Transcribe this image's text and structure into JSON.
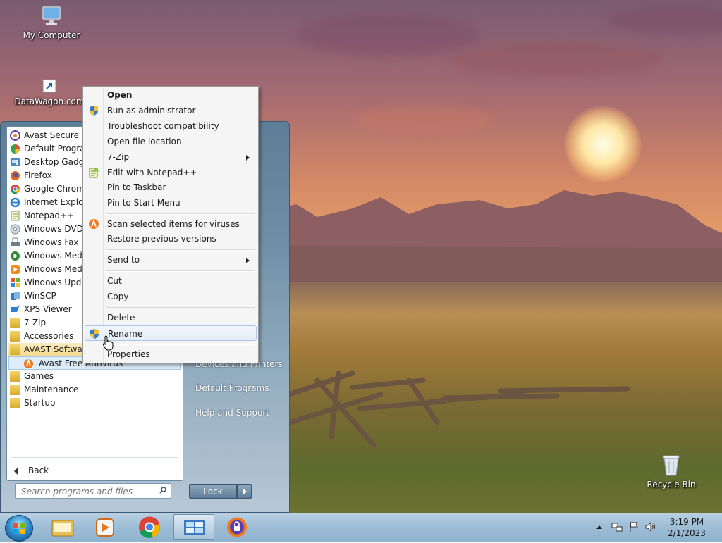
{
  "desktop": {
    "icons": {
      "my_computer": "My Computer",
      "datawagon": "DataWagon.com",
      "recycle_bin": "Recycle Bin"
    }
  },
  "start_menu": {
    "programs": [
      {
        "label": "Avast Secure Bro",
        "icon": "avast-browser-icon"
      },
      {
        "label": "Default Program",
        "icon": "default-programs-icon"
      },
      {
        "label": "Desktop Gadget",
        "icon": "gadgets-icon"
      },
      {
        "label": "Firefox",
        "icon": "firefox-icon"
      },
      {
        "label": "Google Chrome",
        "icon": "chrome-icon"
      },
      {
        "label": "Internet Explore",
        "icon": "ie-icon"
      },
      {
        "label": "Notepad++",
        "icon": "notepadpp-icon"
      },
      {
        "label": "Windows DVD M",
        "icon": "dvd-maker-icon"
      },
      {
        "label": "Windows Fax an",
        "icon": "fax-icon"
      },
      {
        "label": "Windows Media",
        "icon": "media-center-icon"
      },
      {
        "label": "Windows Media",
        "icon": "media-player-icon"
      },
      {
        "label": "Windows Updat",
        "icon": "windows-update-icon"
      },
      {
        "label": "WinSCP",
        "icon": "winscp-icon"
      },
      {
        "label": "XPS Viewer",
        "icon": "xps-viewer-icon"
      },
      {
        "label": "7-Zip",
        "icon": "folder-icon"
      },
      {
        "label": "Accessories",
        "icon": "folder-icon"
      },
      {
        "label": "AVAST Software",
        "icon": "folder-icon"
      },
      {
        "label": "Avast Free Antivirus",
        "icon": "avast-icon"
      },
      {
        "label": "Games",
        "icon": "folder-icon"
      },
      {
        "label": "Maintenance",
        "icon": "folder-icon"
      },
      {
        "label": "Startup",
        "icon": "folder-icon"
      }
    ],
    "back_label": "Back",
    "search_placeholder": "Search programs and files",
    "right_links": {
      "devices_printers": "Devices and Printers",
      "default_programs": "Default Programs",
      "help_support": "Help and Support"
    },
    "lock_label": "Lock"
  },
  "context_menu": {
    "items": [
      {
        "label": "Open",
        "bold": true
      },
      {
        "label": "Run as administrator",
        "icon": "uac-shield-icon"
      },
      {
        "label": "Troubleshoot compatibility"
      },
      {
        "label": "Open file location"
      },
      {
        "label": "7-Zip",
        "submenu": true
      },
      {
        "label": "Edit with Notepad++",
        "icon": "notepadpp-icon"
      },
      {
        "label": "Pin to Taskbar"
      },
      {
        "label": "Pin to Start Menu"
      },
      {
        "label": "Scan selected items for viruses",
        "icon": "avast-icon"
      },
      {
        "label": "Restore previous versions"
      },
      {
        "label": "Send to",
        "submenu": true
      },
      {
        "label": "Cut"
      },
      {
        "label": "Copy"
      },
      {
        "label": "Delete"
      },
      {
        "label": "Rename",
        "icon": "uac-shield-icon"
      },
      {
        "label": "Properties"
      }
    ],
    "hovered": "Rename"
  },
  "taskbar": {
    "pinned": [
      "windows-explorer-icon",
      "windows-media-player-icon",
      "chrome-icon",
      "control-panel-icon",
      "avast-secure-browser-icon"
    ],
    "active": "control-panel-icon",
    "clock": {
      "time": "3:19 PM",
      "date": "2/1/2023"
    }
  },
  "colors": {
    "menu_highlight": "#dcecf8",
    "folder_selected": "#f3d98a",
    "taskbar": "#9ebed6"
  }
}
